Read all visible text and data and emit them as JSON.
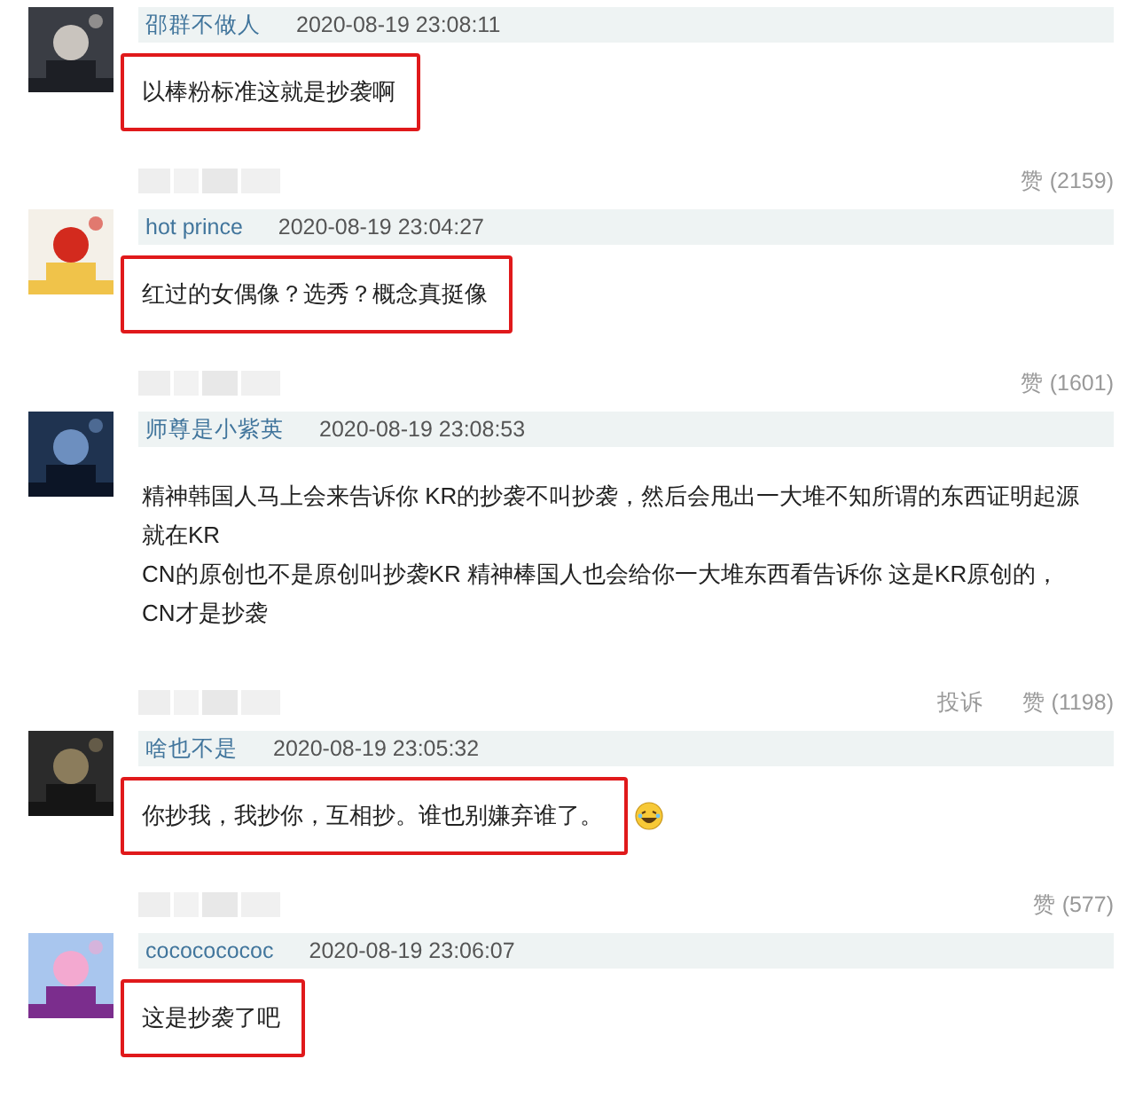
{
  "comments": [
    {
      "user": "邵群不做人",
      "time": "2020-08-19 23:08:11",
      "lines": [
        "以棒粉标准这就是抄袭啊"
      ],
      "highlighted": true,
      "emoji": false,
      "actions": [
        "赞 (2159)"
      ]
    },
    {
      "user": "hot prince",
      "time": "2020-08-19 23:04:27",
      "lines": [
        "红过的女偶像？选秀？概念真挺像"
      ],
      "highlighted": true,
      "emoji": false,
      "actions": [
        "赞 (1601)"
      ]
    },
    {
      "user": "师尊是小紫英",
      "time": "2020-08-19 23:08:53",
      "lines": [
        "精神韩国人马上会来告诉你 KR的抄袭不叫抄袭，然后会甩出一大堆不知所谓的东西证明起源就在KR",
        "CN的原创也不是原创叫抄袭KR 精神棒国人也会给你一大堆东西看告诉你 这是KR原创的，CN才是抄袭"
      ],
      "highlighted": false,
      "emoji": false,
      "actions": [
        "投诉",
        "赞 (1198)"
      ]
    },
    {
      "user": "啥也不是",
      "time": "2020-08-19 23:05:32",
      "lines": [
        "你抄我，我抄你，互相抄。谁也别嫌弃谁了。"
      ],
      "highlighted": true,
      "emoji": true,
      "actions": [
        "赞 (577)"
      ]
    },
    {
      "user": "cocococococ",
      "time": "2020-08-19 23:06:07",
      "lines": [
        "这是抄袭了吧"
      ],
      "highlighted": true,
      "emoji": false
    }
  ]
}
